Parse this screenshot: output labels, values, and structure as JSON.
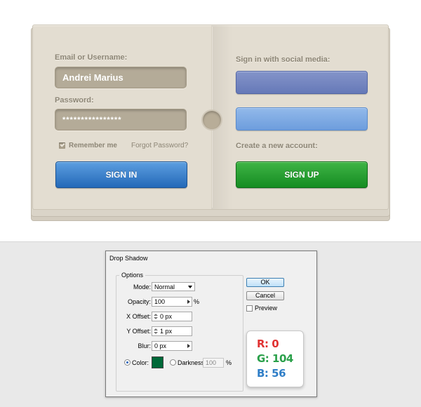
{
  "login": {
    "email_label": "Email or Username:",
    "email_value": "Andrei Marius",
    "password_label": "Password:",
    "password_value": "****************",
    "remember_label": "Remember me",
    "forgot_label": "Forgot Password?",
    "signin_label": "SIGN IN",
    "social_label": "Sign in with social media:",
    "create_label": "Create a new account:",
    "signup_label": "SIGN UP"
  },
  "dialog": {
    "title": "Drop Shadow",
    "options_label": "Options",
    "mode_label": "Mode:",
    "mode_value": "Normal",
    "opacity_label": "Opacity:",
    "opacity_value": "100",
    "opacity_unit": "%",
    "xoffset_label": "X Offset:",
    "xoffset_value": "0 px",
    "yoffset_label": "Y Offset:",
    "yoffset_value": "1 px",
    "blur_label": "Blur:",
    "blur_value": "0 px",
    "color_label": "Color:",
    "color_value": "#006838",
    "darkness_label": "Darkness:",
    "darkness_value": "100",
    "darkness_unit": "%",
    "ok_label": "OK",
    "cancel_label": "Cancel",
    "preview_label": "Preview"
  },
  "rgb_card": {
    "r": "R: 0",
    "g": "G: 104",
    "b": "B: 56"
  }
}
